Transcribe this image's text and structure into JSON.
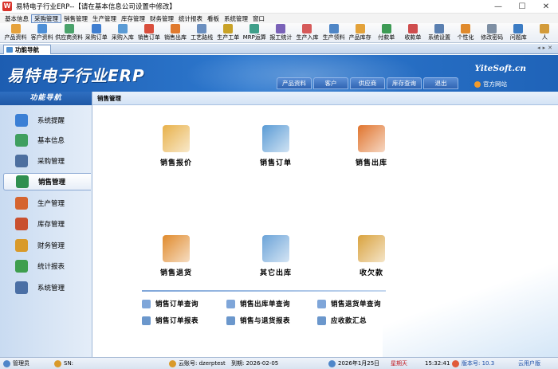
{
  "window": {
    "title": "易特电子行业ERP--【请在基本信息公司设置中修改】"
  },
  "menu": [
    "基本信息",
    "采购管理",
    "销售管理",
    "生产管理",
    "库存管理",
    "财务管理",
    "统计报表",
    "看板",
    "系统管理",
    "窗口"
  ],
  "menu_active": "采购管理",
  "toolbar": [
    {
      "label": "产品资料",
      "color": "#e6a23c"
    },
    {
      "label": "客户资料",
      "color": "#4e8fd6"
    },
    {
      "label": "供应商资料",
      "color": "#4aa26b"
    },
    {
      "label": "采购订单",
      "color": "#3f7ed0"
    },
    {
      "label": "采购入库",
      "color": "#5a9bd5"
    },
    {
      "label": "销售订单",
      "color": "#d94f3d"
    },
    {
      "label": "销售出库",
      "color": "#e07a2e"
    },
    {
      "label": "工艺路线",
      "color": "#6b8fbf"
    },
    {
      "label": "生产工单",
      "color": "#c9a227"
    },
    {
      "label": "MRP运算",
      "color": "#3f9f8a"
    },
    {
      "label": "报工统计",
      "color": "#7a62b8"
    },
    {
      "label": "生产入库",
      "color": "#d65a5a"
    },
    {
      "label": "生产领料",
      "color": "#4f86c6"
    },
    {
      "label": "产品库存",
      "color": "#e3a23a"
    },
    {
      "label": "付款单",
      "color": "#3d9b54"
    },
    {
      "label": "收款单",
      "color": "#cf4d4d"
    },
    {
      "label": "系统设置",
      "color": "#5a7fb0"
    },
    {
      "label": "个性化",
      "color": "#e08a2c"
    },
    {
      "label": "修改密码",
      "color": "#7e8fa3"
    },
    {
      "label": "问题库",
      "color": "#3c7cc4"
    },
    {
      "label": "人",
      "color": "#d39b3a"
    }
  ],
  "tab": {
    "label": "功能导航"
  },
  "banner": {
    "brand": "易特电子行业ERP",
    "nav": [
      "产品资料",
      "客户",
      "供应商",
      "库存查询",
      "退出"
    ],
    "site": "YiteSoft.cn",
    "official_link": "官方网站"
  },
  "sidebar": {
    "title": "功能导航",
    "items": [
      {
        "label": "系统提醒",
        "color": "#3a7fd5"
      },
      {
        "label": "基本信息",
        "color": "#3f9f5f"
      },
      {
        "label": "采购管理",
        "color": "#4d6f9f"
      },
      {
        "label": "销售管理",
        "color": "#2f8f4f"
      },
      {
        "label": "生产管理",
        "color": "#d5642f"
      },
      {
        "label": "库存管理",
        "color": "#c9502f"
      },
      {
        "label": "财务管理",
        "color": "#d99a2a"
      },
      {
        "label": "统计报表",
        "color": "#3e9e4e"
      },
      {
        "label": "系统管理",
        "color": "#4a6fa5"
      }
    ],
    "active": "销售管理"
  },
  "main": {
    "header": "销售管理",
    "cards": [
      {
        "label": "销售报价",
        "icon": "quote-doc-icon",
        "color": "#e8b14a"
      },
      {
        "label": "销售订单",
        "icon": "sales-order-icon",
        "color": "#5a9bd5"
      },
      {
        "label": "销售出库",
        "icon": "delivery-truck-icon",
        "color": "#e0742d"
      },
      {
        "label": "销售退货",
        "icon": "return-truck-icon",
        "color": "#e08a2c"
      },
      {
        "label": "其它出库",
        "icon": "warehouse-icon",
        "color": "#6ba3d8"
      },
      {
        "label": "收欠款",
        "icon": "receivable-icon",
        "color": "#d9a23e"
      }
    ],
    "links": [
      {
        "label": "销售订单查询"
      },
      {
        "label": "销售出库单查询"
      },
      {
        "label": "销售退货单查询"
      },
      {
        "label": "销售订单报表"
      },
      {
        "label": "销售与退货报表"
      },
      {
        "label": "应收款汇总"
      }
    ]
  },
  "statusbar": {
    "user": "管理员",
    "sn": "SN:",
    "account": "云账号: dzerptest",
    "expiry": "到期: 2026-02-05",
    "date": "2026年1月25日",
    "weekday": "星期天",
    "time": "15:32:41",
    "version": "版本号: 10.3",
    "edition": "云用户版"
  }
}
